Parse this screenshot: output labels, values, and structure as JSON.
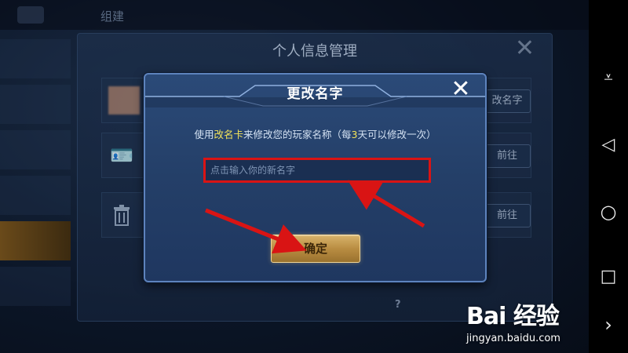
{
  "background": {
    "top_title": "组建",
    "panel_title": "个人信息管理",
    "rows": [
      {
        "button": "改名字"
      },
      {
        "button": "前往"
      },
      {
        "button": "前往"
      }
    ],
    "help_glyph": "?"
  },
  "dialog": {
    "title": "更改名字",
    "instruction_prefix": "使用",
    "instruction_card": "改名卡",
    "instruction_middle": "来修改您的玩家名称（每",
    "instruction_days": "3",
    "instruction_suffix": "天可以修改一次）",
    "input_placeholder": "点击输入你的新名字",
    "input_value": "",
    "confirm_label": "确定",
    "close_icon": "close-icon"
  },
  "navbar": {
    "items": [
      {
        "icon": "collapse-icon",
        "glyph": "⩡"
      },
      {
        "icon": "back-icon",
        "glyph": "◁"
      },
      {
        "icon": "home-icon",
        "glyph": "○"
      },
      {
        "icon": "recents-icon",
        "glyph": "□"
      },
      {
        "icon": "chevron-right-icon",
        "glyph": "›"
      }
    ]
  },
  "watermark": {
    "logo": "Bai  经验",
    "url": "jingyan.baidu.com"
  },
  "colors": {
    "highlight": "#f4e45a",
    "annotation": "#d91414",
    "confirm": "#c9a055"
  }
}
